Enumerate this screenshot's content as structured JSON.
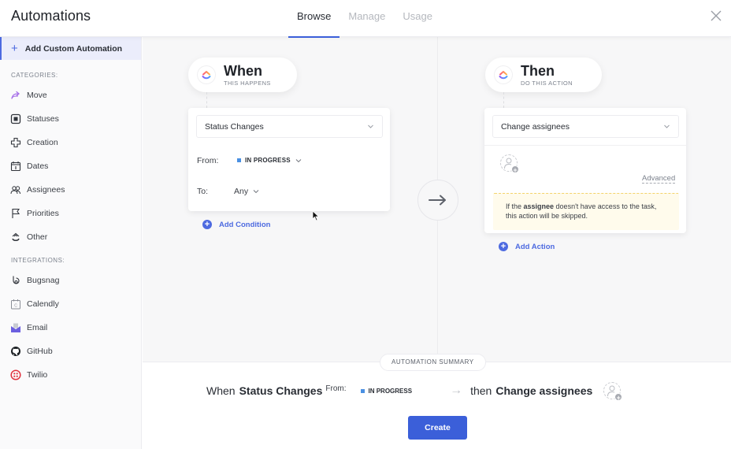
{
  "header": {
    "title": "Automations",
    "tabs": [
      {
        "label": "Browse",
        "active": true
      },
      {
        "label": "Manage",
        "active": false
      },
      {
        "label": "Usage",
        "active": false
      }
    ],
    "close_icon": "close-icon"
  },
  "sidebar": {
    "add_custom_label": "Add Custom Automation",
    "categories_label": "CATEGORIES:",
    "categories": [
      {
        "label": "Move",
        "icon": "move-arrow-icon"
      },
      {
        "label": "Statuses",
        "icon": "status-square-icon"
      },
      {
        "label": "Creation",
        "icon": "creation-plus-icon"
      },
      {
        "label": "Dates",
        "icon": "calendar-icon"
      },
      {
        "label": "Assignees",
        "icon": "assignees-icon"
      },
      {
        "label": "Priorities",
        "icon": "flag-icon"
      },
      {
        "label": "Other",
        "icon": "other-icon"
      }
    ],
    "integrations_label": "INTEGRATIONS:",
    "integrations": [
      {
        "label": "Bugsnag",
        "icon": "bugsnag-icon"
      },
      {
        "label": "Calendly",
        "icon": "calendly-icon"
      },
      {
        "label": "Email",
        "icon": "email-icon"
      },
      {
        "label": "GitHub",
        "icon": "github-icon"
      },
      {
        "label": "Twilio",
        "icon": "twilio-icon"
      }
    ]
  },
  "trigger": {
    "title": "When",
    "subtitle": "THIS HAPPENS",
    "select_value": "Status Changes",
    "from_label": "From:",
    "from_value": "IN PROGRESS",
    "from_color": "#4a90e2",
    "to_label": "To:",
    "to_value": "Any",
    "add_condition_label": "Add Condition"
  },
  "action": {
    "title": "Then",
    "subtitle": "DO THIS ACTION",
    "select_value": "Change assignees",
    "advanced_label": "Advanced",
    "warning_prefix": "If the ",
    "warning_bold": "assignee",
    "warning_suffix": " doesn't have access to the task, this action will be skipped.",
    "add_action_label": "Add Action"
  },
  "summary": {
    "badge": "AUTOMATION SUMMARY",
    "when": "When",
    "trigger": "Status Changes",
    "from_label": "From:",
    "from_value": "IN PROGRESS",
    "arrow": "→",
    "then": "then",
    "action": "Change assignees",
    "create_label": "Create"
  },
  "colors": {
    "accent": "#3b5fd9",
    "status_in_progress": "#4a90e2",
    "warning_bg": "#fffbec"
  }
}
